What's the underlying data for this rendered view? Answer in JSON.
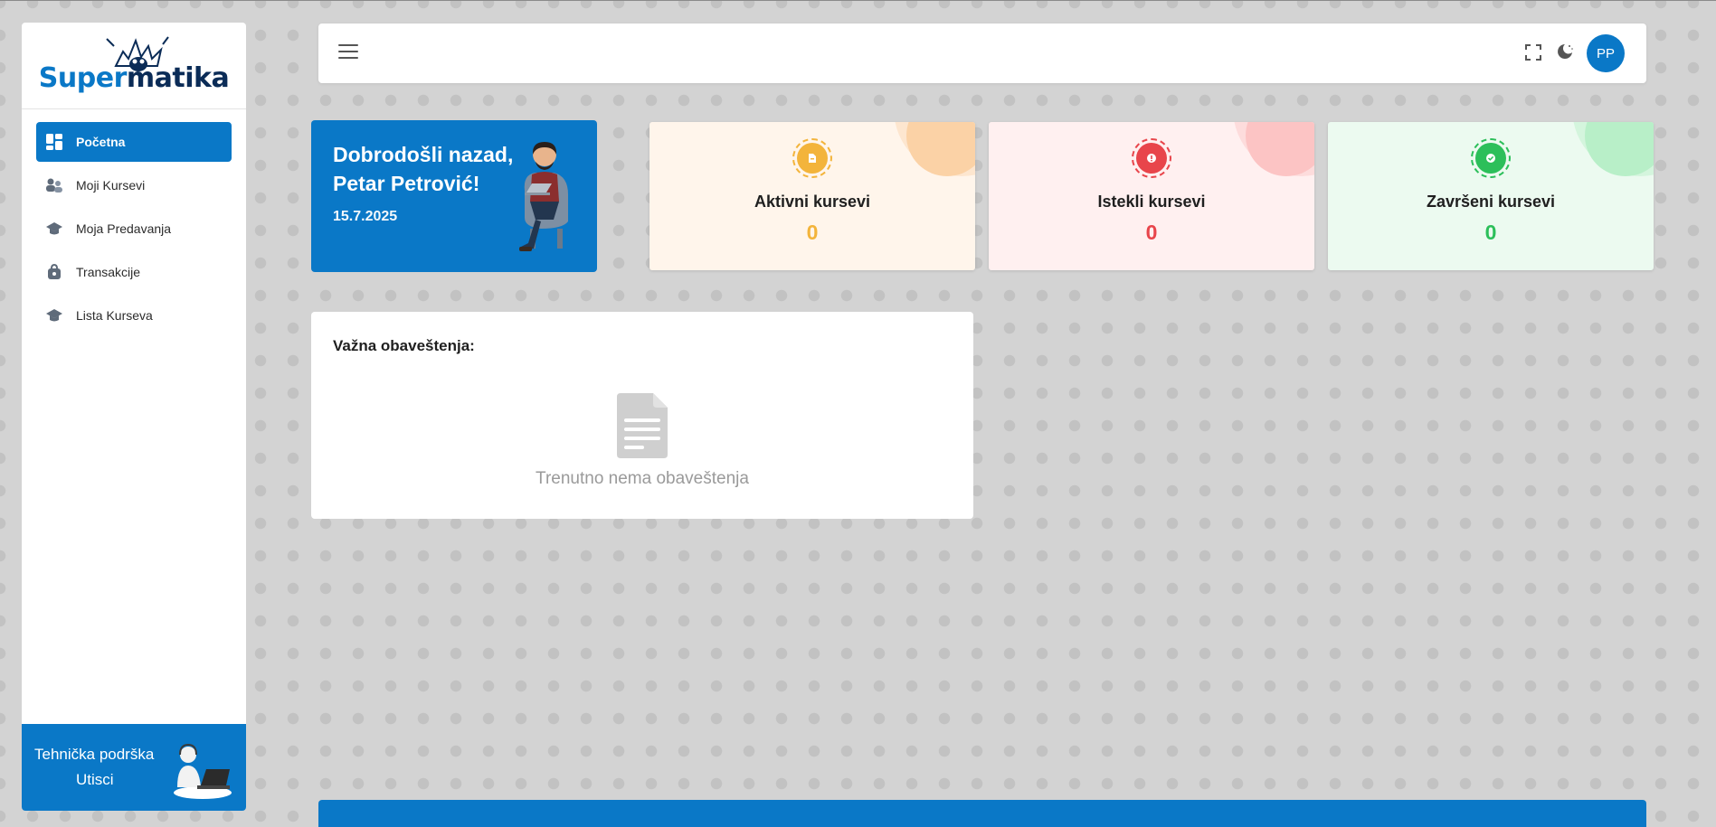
{
  "app": {
    "logo": {
      "part1": "Super",
      "part2": "matika"
    }
  },
  "colors": {
    "primary": "#0a78c7",
    "amber": "#f3b43b",
    "red": "#e8454b",
    "green": "#2cbf5a"
  },
  "sidebar": {
    "items": [
      {
        "label": "Početna",
        "icon": "dashboard-icon",
        "active": true
      },
      {
        "label": "Moji Kursevi",
        "icon": "users-icon"
      },
      {
        "label": "Moja Predavanja",
        "icon": "graduation-cap-icon"
      },
      {
        "label": "Transakcije",
        "icon": "wallet-icon"
      },
      {
        "label": "Lista Kurseva",
        "icon": "graduation-cap-icon"
      }
    ],
    "support": {
      "line1": "Tehnička podrška",
      "line2": "Utisci"
    }
  },
  "header": {
    "avatar_initials": "PP"
  },
  "welcome": {
    "title": "Dobrodošli nazad, Petar Petrović!",
    "date": "15.7.2025"
  },
  "stats": [
    {
      "label": "Aktivni kursevi",
      "value": "0",
      "icon": "book-icon"
    },
    {
      "label": "Istekli kursevi",
      "value": "0",
      "icon": "alert-icon"
    },
    {
      "label": "Završeni kursevi",
      "value": "0",
      "icon": "check-icon"
    }
  ],
  "notifications": {
    "heading": "Važna obaveštenja:",
    "empty_text": "Trenutno nema obaveštenja"
  }
}
